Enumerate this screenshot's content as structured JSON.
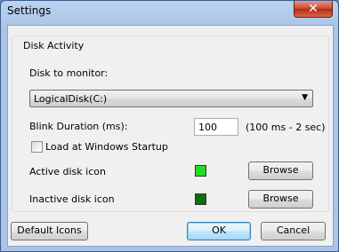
{
  "window": {
    "title": "Settings",
    "close_symbol": "✕"
  },
  "group": {
    "title": "Disk Activity"
  },
  "disk": {
    "label": "Disk to monitor:",
    "selected": "LogicalDisk(C:)",
    "arrow": "▼"
  },
  "blink": {
    "label": "Blink Duration (ms):",
    "value": "100",
    "hint": "(100 ms - 2 sec)"
  },
  "startup": {
    "label": "Load at Windows Startup",
    "checked": false
  },
  "active_icon": {
    "label": "Active disk icon",
    "color": "#22dd22",
    "browse_label": "Browse"
  },
  "inactive_icon": {
    "label": "Inactive disk icon",
    "color": "#0d6e0d",
    "browse_label": "Browse"
  },
  "buttons": {
    "default_icons": "Default Icons",
    "ok": "OK",
    "cancel": "Cancel"
  }
}
